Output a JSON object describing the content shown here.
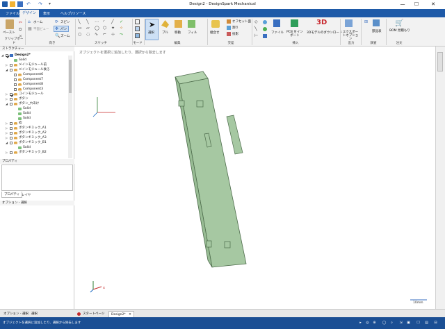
{
  "window": {
    "title": "Design2 - DesignSpark Mechanical",
    "min": "—",
    "max": "☐",
    "close": "✕"
  },
  "ribbon_tabs": [
    "ファイル",
    "デザイン",
    "表示",
    "ヘルプ/リソース"
  ],
  "ribbon": {
    "paste": "ペースト",
    "home": "ホーム",
    "select_grid": "平面ビュー",
    "zoom": "ズーム",
    "spin": "スピン",
    "pan": "パン",
    "select": "選択",
    "pull": "プル",
    "move": "移動",
    "fill": "フィル",
    "combine": "組合せ",
    "shell": "オフセット面",
    "split": "割り",
    "project": "投影",
    "file": "ファイル",
    "pcb": "PCB をインポート",
    "download3d": "3Dモデルのダウンロード",
    "export": "エクスポートオプション",
    "parts": "部品表",
    "bom": "BOM 見積もり",
    "groups": {
      "clipboard": "クリップボード",
      "orient": "向き",
      "sketch": "スケッチ",
      "mode": "モード",
      "edit": "編集",
      "intersect": "交差",
      "insert": "挿入",
      "output": "出力",
      "investigate": "調査",
      "order": "注文"
    }
  },
  "structure": {
    "header": "ストラクチャー",
    "rows": [
      {
        "label": "Design2*",
        "depth": 0,
        "expanded": true,
        "checked": true,
        "bold": true,
        "icon": "design"
      },
      {
        "label": "Solid",
        "depth": 1,
        "expanded": null,
        "checked": null,
        "icon": "solid"
      },
      {
        "label": "メインモジュール前",
        "depth": 1,
        "expanded": false,
        "checked": false,
        "icon": "component"
      },
      {
        "label": "メインモジュール後ろ",
        "depth": 1,
        "expanded": true,
        "checked": false,
        "icon": "component"
      },
      {
        "label": "Component6",
        "depth": 2,
        "expanded": null,
        "checked": false,
        "icon": "component"
      },
      {
        "label": "Component7",
        "depth": 2,
        "expanded": null,
        "checked": false,
        "icon": "component"
      },
      {
        "label": "Component8",
        "depth": 2,
        "expanded": null,
        "checked": false,
        "icon": "component"
      },
      {
        "label": "Component3",
        "depth": 2,
        "expanded": null,
        "checked": false,
        "icon": "component"
      },
      {
        "label": "コインモジュール",
        "depth": 1,
        "expanded": false,
        "checked": true,
        "icon": "component"
      },
      {
        "label": "ボタン",
        "depth": 1,
        "expanded": false,
        "checked": false,
        "icon": "component"
      },
      {
        "label": "ボタン_穴あけ",
        "depth": 1,
        "expanded": true,
        "checked": false,
        "icon": "component"
      },
      {
        "label": "Solid",
        "depth": 2,
        "expanded": null,
        "checked": null,
        "icon": "solid"
      },
      {
        "label": "Solid",
        "depth": 2,
        "expanded": null,
        "checked": null,
        "icon": "solid"
      },
      {
        "label": "Solid",
        "depth": 2,
        "expanded": null,
        "checked": null,
        "icon": "solid"
      },
      {
        "label": "枠",
        "depth": 1,
        "expanded": false,
        "checked": false,
        "icon": "component"
      },
      {
        "label": "ボタンギミック_A1",
        "depth": 1,
        "expanded": false,
        "checked": false,
        "icon": "component"
      },
      {
        "label": "ボタンギミック_A2",
        "depth": 1,
        "expanded": false,
        "checked": false,
        "icon": "component"
      },
      {
        "label": "ボタンギミック_A3",
        "depth": 1,
        "expanded": false,
        "checked": false,
        "icon": "component"
      },
      {
        "label": "ボタンギミック_B1",
        "depth": 1,
        "expanded": true,
        "checked": false,
        "icon": "component"
      },
      {
        "label": "Solid",
        "depth": 2,
        "expanded": null,
        "checked": null,
        "icon": "solid"
      },
      {
        "label": "ボタンギミック_B2",
        "depth": 1,
        "expanded": false,
        "checked": false,
        "icon": "component"
      }
    ]
  },
  "properties": {
    "header": "プロパティ",
    "tabs": [
      "プロパティ",
      "レイヤ"
    ]
  },
  "options": {
    "header": "オプション - 選択"
  },
  "canvas": {
    "hint": "オブジェクトを選択に追加したり、選択から除去します",
    "scale_label": "10mm",
    "model_color": "#a6c8a2",
    "model_edge": "#4d6b4b"
  },
  "bottom_left_tabs": [
    "オプション - 選択",
    "選択"
  ],
  "doc_tabs": [
    {
      "label": "スタートページ",
      "active": false
    },
    {
      "label": "Design2*",
      "active": true
    }
  ],
  "status": {
    "text": "オブジェクトを選択に追加したり、選択から除去します"
  },
  "colors": {
    "accent": "#1e5aa8",
    "status_bar": "#1b4f94"
  }
}
